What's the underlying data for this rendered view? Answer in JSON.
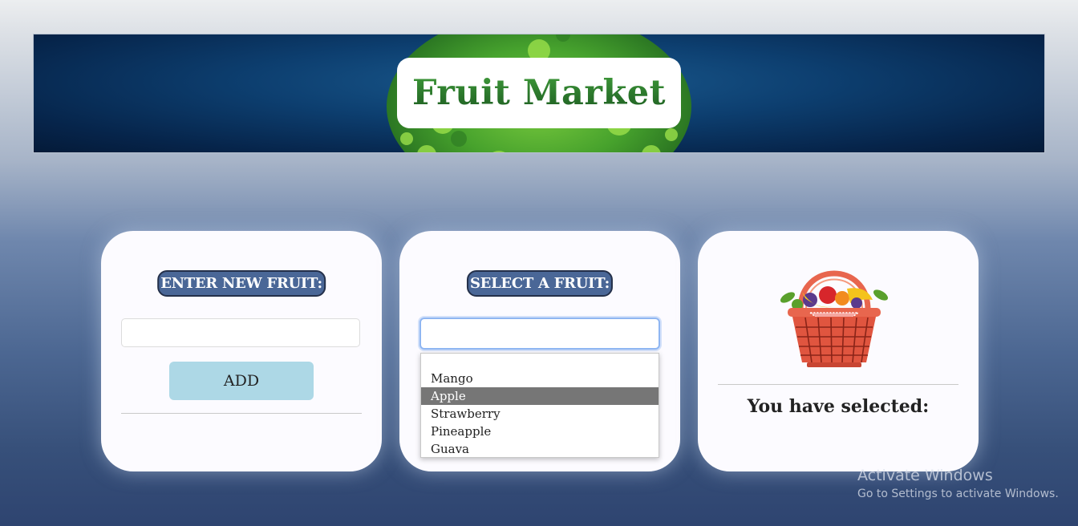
{
  "header": {
    "title": "Fruit Market"
  },
  "add_card": {
    "label": "ENTER NEW FRUIT:",
    "input_value": "",
    "button_label": "ADD"
  },
  "select_card": {
    "label": "SELECT A FRUIT:",
    "input_value": "",
    "options": [
      "Mango",
      "Apple",
      "Strawberry",
      "Pineapple",
      "Guava"
    ],
    "highlighted_option": "Apple"
  },
  "result_card": {
    "selected_label": "You have selected:",
    "image": "fruit-basket-icon"
  },
  "watermark": {
    "title": "Activate Windows",
    "subtitle": "Go to Settings to activate Windows."
  },
  "colors": {
    "label_bg": "#4a6797",
    "button_bg": "#add8e6",
    "highlight_bg": "#767676",
    "title_green": "#2d7a2d"
  }
}
